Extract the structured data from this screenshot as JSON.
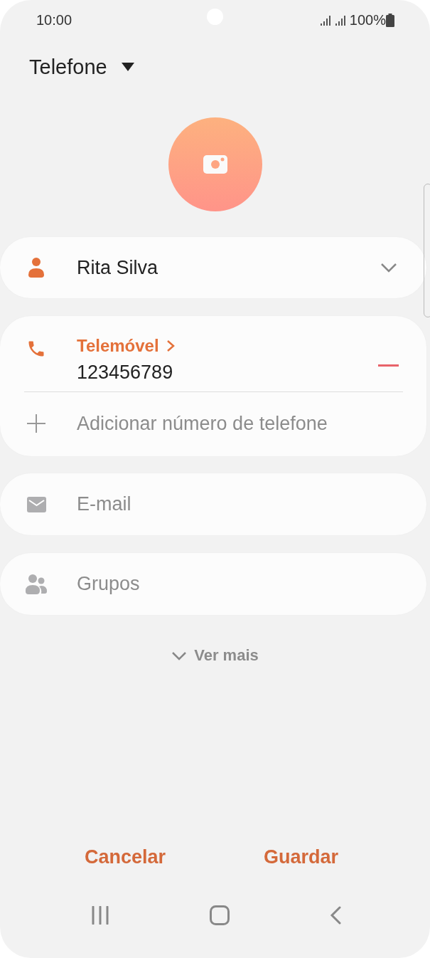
{
  "status_bar": {
    "time": "10:00",
    "battery": "100%"
  },
  "header": {
    "account": "Telefone"
  },
  "name_field": {
    "value": "Rita Silva"
  },
  "phone": {
    "label": "Telemóvel",
    "number": "123456789",
    "add_placeholder": "Adicionar número de telefone"
  },
  "email": {
    "placeholder": "E-mail"
  },
  "groups": {
    "placeholder": "Grupos"
  },
  "more": {
    "label": "Ver mais"
  },
  "buttons": [
    "Cancelar",
    "Guardar"
  ]
}
